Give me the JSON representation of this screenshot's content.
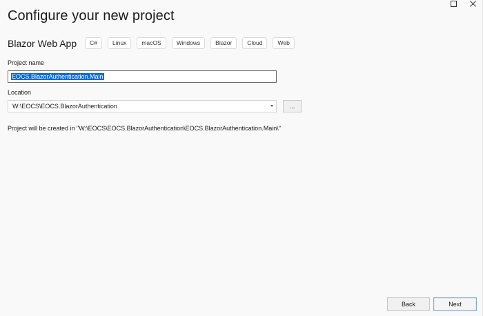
{
  "window": {
    "controls": {
      "maximize_icon": "maximize-icon",
      "close_icon": "close-icon"
    }
  },
  "header": {
    "title": "Configure your new project"
  },
  "template": {
    "name": "Blazor Web App",
    "tags": [
      "C#",
      "Linux",
      "macOS",
      "Windows",
      "Blazor",
      "Cloud",
      "Web"
    ]
  },
  "project_name": {
    "label": "Project name",
    "value": "EOCS.BlazorAuthentication.Main"
  },
  "location": {
    "label": "Location",
    "value": "W:\\EOCS\\EOCS.BlazorAuthentication",
    "browse_label": "..."
  },
  "info": {
    "text": "Project will be created in \"W:\\EOCS\\EOCS.BlazorAuthentication\\EOCS.BlazorAuthentication.Main\\\""
  },
  "footer": {
    "back_label": "Back",
    "next_label": "Next"
  },
  "colors": {
    "background": "#f9f9f9",
    "selection": "#0b6ad4",
    "primary_border": "#8aa9d8"
  }
}
